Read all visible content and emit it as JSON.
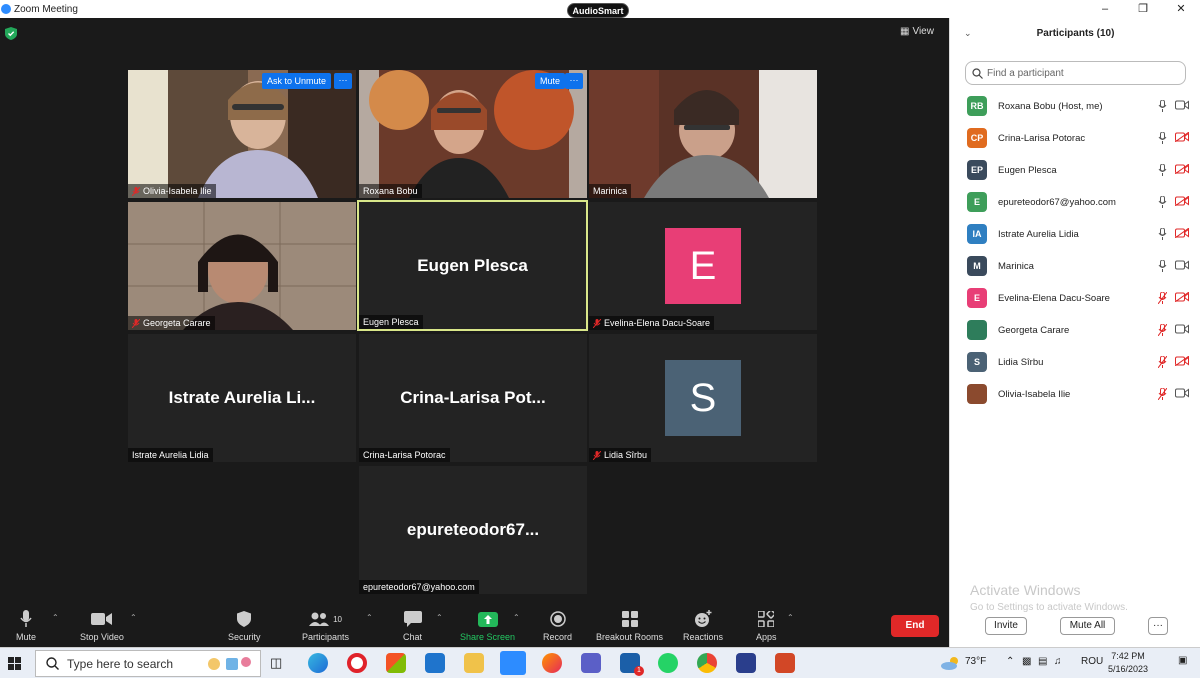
{
  "window": {
    "title": "Zoom Meeting",
    "badge": "AudioSmart",
    "view_label": "View"
  },
  "colors": {
    "zoom_blue": "#2D8CFF",
    "end_red": "#E02828",
    "active_border": "#d9e78a",
    "mute_red": "#E02828"
  },
  "tiles": [
    {
      "name": "Olivia-Isabela Ilie",
      "muted": true,
      "overlay": "Ask to Unmute",
      "dots": "···"
    },
    {
      "name": "Roxana Bobu",
      "muted": false,
      "overlay": "Mute",
      "dots": "···"
    },
    {
      "name": "Marinica",
      "muted": false
    },
    {
      "name": "Georgeta Carare",
      "muted": true
    },
    {
      "name": "Eugen Plesca",
      "muted": false,
      "big": "Eugen Plesca"
    },
    {
      "name": "Evelina-Elena Dacu-Soare",
      "muted": true,
      "letter": "E",
      "color": "#E83E76"
    },
    {
      "name": "Istrate Aurelia Lidia",
      "muted": false,
      "big": "Istrate  Aurelia  Li..."
    },
    {
      "name": "Crina-Larisa Potorac",
      "muted": false,
      "big": "Crina-Larisa  Pot..."
    },
    {
      "name": "Lidia Sîrbu",
      "muted": true,
      "letter": "S",
      "color": "#4B6275"
    },
    {
      "name": "epureteodor67@yahoo.com",
      "muted": false,
      "big": "epureteodor67..."
    }
  ],
  "toolbar": {
    "mute": "Mute",
    "stop_video": "Stop Video",
    "security": "Security",
    "participants": "Participants",
    "participants_count": "10",
    "chat": "Chat",
    "share_screen": "Share Screen",
    "record": "Record",
    "breakout_rooms": "Breakout Rooms",
    "reactions": "Reactions",
    "apps": "Apps",
    "end": "End"
  },
  "panel": {
    "title": "Participants (10)",
    "search_placeholder": "Find a participant",
    "participants": [
      {
        "initials": "RB",
        "name": "Roxana Bobu (Host, me)",
        "color": "#3E9E5A",
        "mic": "on",
        "video": "on"
      },
      {
        "initials": "CP",
        "name": "Crina-Larisa Potorac",
        "color": "#E06B1F",
        "mic": "on",
        "video": "off"
      },
      {
        "initials": "EP",
        "name": "Eugen Plesca",
        "color": "#3A4A5C",
        "mic": "on",
        "video": "off"
      },
      {
        "initials": "E",
        "name": "epureteodor67@yahoo.com",
        "color": "#3E9E5A",
        "mic": "on",
        "video": "off"
      },
      {
        "initials": "IA",
        "name": "Istrate Aurelia Lidia",
        "color": "#2F7FC1",
        "mic": "on",
        "video": "off"
      },
      {
        "initials": "M",
        "name": "Marinica",
        "color": "#3A4A5C",
        "mic": "on",
        "video": "on"
      },
      {
        "initials": "E",
        "name": "Evelina-Elena Dacu-Soare",
        "color": "#E83E76",
        "mic": "off",
        "video": "off"
      },
      {
        "initials": "",
        "name": "Georgeta Carare",
        "color": "#2E7D5B",
        "mic": "off",
        "video": "on"
      },
      {
        "initials": "S",
        "name": "Lidia Sîrbu",
        "color": "#4B6275",
        "mic": "off",
        "video": "off"
      },
      {
        "initials": "",
        "name": "Olivia-Isabela Ilie",
        "color": "#8B4A2E",
        "mic": "off",
        "video": "on"
      }
    ],
    "activate_title": "Activate Windows",
    "activate_sub": "Go to Settings to activate Windows.",
    "invite": "Invite",
    "mute_all": "Mute All",
    "more": "···"
  },
  "taskbar": {
    "search_placeholder": "Type here to search",
    "weather": "73°F",
    "language": "ROU",
    "time": "7:42 PM",
    "date": "5/16/2023",
    "notif_badge": "1"
  }
}
